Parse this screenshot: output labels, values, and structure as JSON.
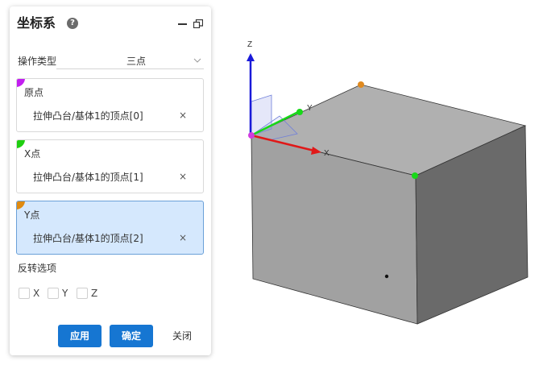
{
  "panel": {
    "title": "坐标系",
    "help_icon": "?",
    "type_label": "操作类型",
    "type_value": "三点",
    "points": [
      {
        "title": "原点",
        "value": "拉伸凸台/基体1的顶点[0]",
        "marker_color": "#c21ef0",
        "active": false
      },
      {
        "title": "X点",
        "value": "拉伸凸台/基体1的顶点[1]",
        "marker_color": "#1fcf10",
        "active": false
      },
      {
        "title": "Y点",
        "value": "拉伸凸台/基体1的顶点[2]",
        "marker_color": "#e08a10",
        "active": true
      }
    ],
    "clear_icon": "×",
    "reverse_label": "反转选项",
    "checkboxes": [
      "X",
      "Y",
      "Z"
    ],
    "buttons": {
      "apply": "应用",
      "ok": "确定",
      "close": "关闭"
    }
  },
  "viewport": {
    "axis_labels": {
      "z": "Z",
      "y": "Y",
      "x": "X"
    },
    "colors": {
      "z_axis": "#1a1ad9",
      "y_axis": "#18d818",
      "x_axis": "#e01818",
      "origin_point": "#d13ce0",
      "x_point": "#18d818",
      "y_point": "#e08a20",
      "box_front": "#a1a1a1",
      "box_top": "#b0b0b0",
      "box_side": "#6a6a6a"
    }
  }
}
